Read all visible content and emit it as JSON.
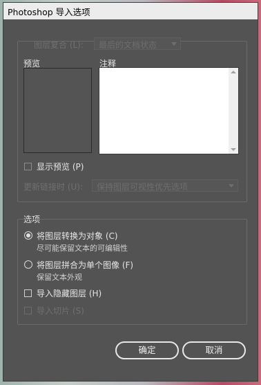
{
  "window": {
    "title": "Photoshop 导入选项"
  },
  "layer_comp": {
    "label": "图层复合 (L):",
    "value": "最后的文档状态"
  },
  "preview": {
    "label": "预览"
  },
  "notes": {
    "label": "注释"
  },
  "show_preview": {
    "label": "显示预览 (P)",
    "checked": false
  },
  "update_links": {
    "label": "更新链接时 (U):",
    "value": "保持图层可视性优先选项"
  },
  "options": {
    "title": "选项",
    "convert_layers": {
      "label": "将图层转换为对象 (C)",
      "desc": "尽可能保留文本的可编辑性",
      "selected": true
    },
    "flatten_layers": {
      "label": "将图层拼合为单个图像 (F)",
      "desc": "保留文本外观",
      "selected": false
    },
    "import_hidden": {
      "label": "导入隐藏图层 (H)",
      "checked": false
    },
    "import_slices": {
      "label": "导入切片 (S)",
      "checked": false
    }
  },
  "buttons": {
    "ok": "确定",
    "cancel": "取消"
  }
}
